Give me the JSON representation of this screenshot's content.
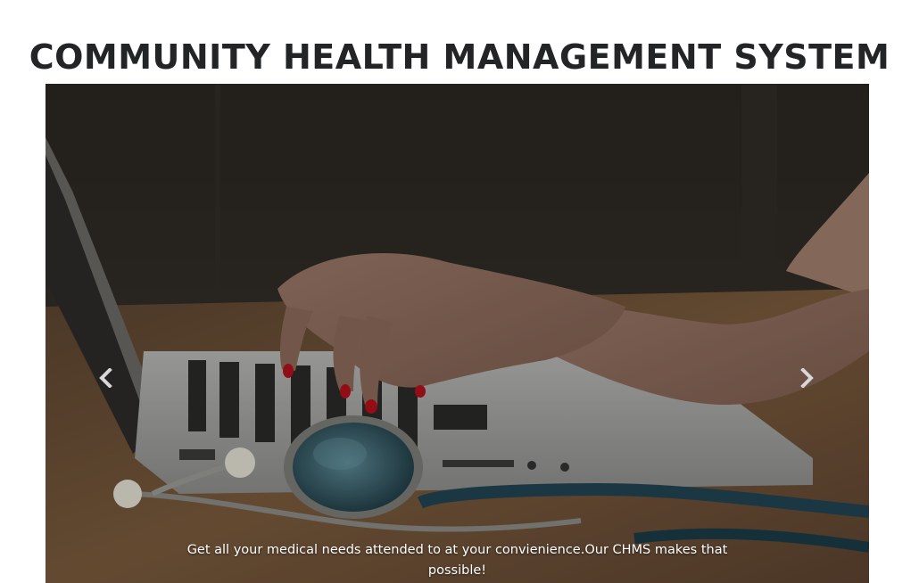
{
  "page": {
    "title": "COMMUNITY HEALTH MANAGEMENT SYSTEM"
  },
  "carousel": {
    "caption": "Get all your medical needs attended to at your convienience.Our CHMS makes that possible!",
    "prev_icon": "chevron-left-icon",
    "next_icon": "chevron-right-icon",
    "slide_image": "laptop-typing-stethoscope-photo"
  },
  "colors": {
    "title_text": "#222426",
    "caption_text": "#ffffff",
    "control_arrow": "#d8d8d8"
  }
}
